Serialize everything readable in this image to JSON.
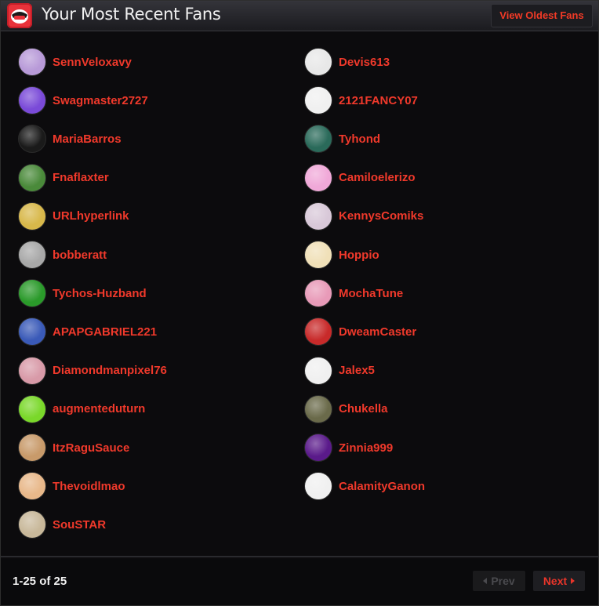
{
  "header": {
    "title": "Your Most Recent Fans",
    "view_oldest_label": "View Oldest Fans"
  },
  "fans": [
    {
      "name": "SennVeloxavy",
      "avatar_color": "#b89ad8"
    },
    {
      "name": "Swagmaster2727",
      "avatar_color": "#7a4ad8"
    },
    {
      "name": "MariaBarros",
      "avatar_color": "#1a1a1a"
    },
    {
      "name": "Fnaflaxter",
      "avatar_color": "#4a8a3a"
    },
    {
      "name": "URLhyperlink",
      "avatar_color": "#d8b84a"
    },
    {
      "name": "bobberatt",
      "avatar_color": "#a8a8a8"
    },
    {
      "name": "Tychos-Huzband",
      "avatar_color": "#2a9a2a"
    },
    {
      "name": "APAPGABRIEL221",
      "avatar_color": "#3a5ab8"
    },
    {
      "name": "Diamondmanpixel76",
      "avatar_color": "#d89aa8"
    },
    {
      "name": "augmenteduturn",
      "avatar_color": "#7ad82a"
    },
    {
      "name": "ItzRaguSauce",
      "avatar_color": "#c89a6a"
    },
    {
      "name": "Thevoidlmao",
      "avatar_color": "#e8b88a"
    },
    {
      "name": "SouSTAR",
      "avatar_color": "#c8b89a"
    },
    {
      "name": "Devis613",
      "avatar_color": "#e8e8e8"
    },
    {
      "name": "2121FANCY07",
      "avatar_color": "#f0f0f0"
    },
    {
      "name": "Tyhond",
      "avatar_color": "#2a6a5a"
    },
    {
      "name": "Camiloelerizo",
      "avatar_color": "#f0a8d8"
    },
    {
      "name": "KennysComiks",
      "avatar_color": "#d8c8d8"
    },
    {
      "name": "Hoppio",
      "avatar_color": "#f0e0b8"
    },
    {
      "name": "MochaTune",
      "avatar_color": "#e89ab8"
    },
    {
      "name": "DweamCaster",
      "avatar_color": "#c82a2a"
    },
    {
      "name": "Jalex5",
      "avatar_color": "#f0f0f0"
    },
    {
      "name": "Chukella",
      "avatar_color": "#6a6a4a"
    },
    {
      "name": "Zinnia999",
      "avatar_color": "#5a1a8a"
    },
    {
      "name": "CalamityGanon",
      "avatar_color": "#f0f0f0"
    }
  ],
  "footer": {
    "range_text": "1-25 of 25",
    "prev_label": "Prev",
    "next_label": "Next"
  },
  "colors": {
    "accent": "#f0392b",
    "background": "#0c0b0d"
  }
}
